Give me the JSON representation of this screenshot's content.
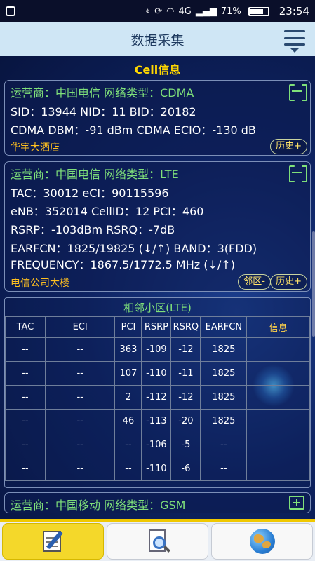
{
  "status_bar": {
    "network": "4G",
    "battery": "71%",
    "time": "23:54"
  },
  "header": {
    "title": "数据采集"
  },
  "section_title": "Cell信息",
  "cdma_card": {
    "line1": "运营商：中国电信  网络类型：CDMA",
    "line2": "SID：13944  NID：11  BID：20182",
    "line3": "CDMA DBM：-91 dBm  CDMA ECIO：-130 dB",
    "location": "华宇大酒店",
    "history_button": "历史+"
  },
  "lte_card": {
    "line1": "运营商：中国电信  网络类型：LTE",
    "line2": "TAC：30012  eCI：90115596",
    "line3": "eNB：352014  CellID：12  PCI：460",
    "line4": "RSRP：-103dBm  RSRQ：-7dB",
    "line5": "EARFCN：1825/19825 (↓/↑)  BAND：3(FDD)",
    "line6": "FREQUENCY：1867.5/1772.5 MHz (↓/↑)",
    "location": "电信公司大楼",
    "neighbor_button": "邻区-",
    "history_button": "历史+"
  },
  "neighbor_table": {
    "title": "相邻小区(LTE)",
    "headers": [
      "TAC",
      "ECI",
      "PCI",
      "RSRP",
      "RSRQ",
      "EARFCN",
      "信息"
    ],
    "rows": [
      [
        "--",
        "--",
        "363",
        "-109",
        "-12",
        "1825",
        ""
      ],
      [
        "--",
        "--",
        "107",
        "-110",
        "-11",
        "1825",
        ""
      ],
      [
        "--",
        "--",
        "2",
        "-112",
        "-12",
        "1825",
        ""
      ],
      [
        "--",
        "--",
        "46",
        "-113",
        "-20",
        "1825",
        ""
      ],
      [
        "--",
        "--",
        "--",
        "-106",
        "-5",
        "--",
        ""
      ],
      [
        "--",
        "--",
        "--",
        "-110",
        "-6",
        "--",
        ""
      ]
    ]
  },
  "gsm_card": {
    "line1": "运营商：中国移动  网络类型：GSM"
  },
  "bottom_nav": {
    "items": [
      {
        "icon": "notepad-pen-icon",
        "active": true
      },
      {
        "icon": "document-search-icon",
        "active": false
      },
      {
        "icon": "globe-icon",
        "active": false
      }
    ]
  },
  "colors": {
    "header_bg": "#cfe6f5",
    "accent_green": "#7fe07a",
    "accent_yellow": "#ffd700",
    "active_tab": "#f4d82a"
  }
}
